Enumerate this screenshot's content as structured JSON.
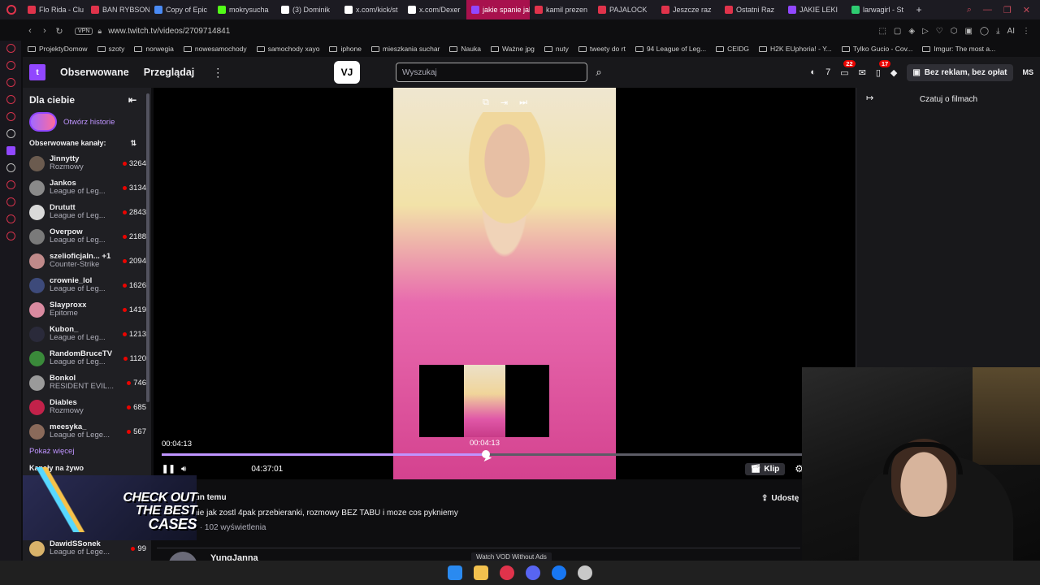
{
  "browser": {
    "tabs": [
      {
        "label": "Flo Rida - Clu",
        "color": "#e0334b"
      },
      {
        "label": "BAN RYBSON",
        "color": "#e0334b"
      },
      {
        "label": "Copy of Epic",
        "color": "#4a8af4"
      },
      {
        "label": "mokrysucha",
        "color": "#53fc18"
      },
      {
        "label": "(3) Dominik",
        "color": "#ffffff"
      },
      {
        "label": "x.com/kick/st",
        "color": "#ffffff"
      },
      {
        "label": "x.com/Dexer",
        "color": "#ffffff"
      },
      {
        "label": "jakie spanie jak zos",
        "color": "#9147ff",
        "active": true
      },
      {
        "label": "kamil prezen",
        "color": "#e0334b"
      },
      {
        "label": "PAJALOCK",
        "color": "#e0334b"
      },
      {
        "label": "Jeszcze raz",
        "color": "#e0334b"
      },
      {
        "label": "Ostatni Raz",
        "color": "#e0334b"
      },
      {
        "label": "JAKIE LEKI",
        "color": "#9147ff"
      },
      {
        "label": "larwagirl - St",
        "color": "#2ecc71"
      }
    ],
    "url": "www.twitch.tv/videos/2709714841",
    "vpn_label": "VPN",
    "bookmarks": [
      "ProjektyDomow",
      "szoty",
      "norwegia",
      "nowesamochody",
      "samochody xayo",
      "iphone",
      "mieszkania suchar",
      "Nauka",
      "Ważne jpg",
      "nuty",
      "tweety do rt",
      "94 League of Leg...",
      "CEIDG",
      "H2K EUphoria! - Y...",
      "Tylko Gucio - Cov...",
      "Imgur: The most a..."
    ]
  },
  "twitch": {
    "nav": {
      "following": "Obserwowane",
      "browse": "Przeglądaj",
      "search_placeholder": "Wyszukaj",
      "notif_count": "22",
      "inbox_count": "17",
      "adfree": "Bez reklam, bez opłat",
      "user_initials": "MS",
      "ai_label": "AI"
    },
    "sidebar": {
      "title": "Dla ciebie",
      "story_label": "Otwórz historie",
      "followed_title": "Obserwowane kanały:",
      "channels": [
        {
          "name": "Jinnytty",
          "category": "Rozmowy",
          "viewers": "3264",
          "color": "#6b5b4f"
        },
        {
          "name": "Jankos",
          "category": "League of Leg...",
          "viewers": "3134",
          "color": "#8a8a8a"
        },
        {
          "name": "Drututt",
          "category": "League of Leg...",
          "viewers": "2843",
          "color": "#d9d9d9"
        },
        {
          "name": "Overpow",
          "category": "League of Leg...",
          "viewers": "2188",
          "color": "#7a7a7a"
        },
        {
          "name": "szelioficjaln... +1",
          "category": "Counter-Strike",
          "viewers": "2094",
          "color": "#c08a8a"
        },
        {
          "name": "crownie_lol",
          "category": "League of Leg...",
          "viewers": "1626",
          "color": "#3d4a7a"
        },
        {
          "name": "Slayproxx",
          "category": "Epitome",
          "viewers": "1419",
          "color": "#d98aa0"
        },
        {
          "name": "Kubon_",
          "category": "League of Leg...",
          "viewers": "1213",
          "color": "#2a2a3a"
        },
        {
          "name": "RandomBruceTV",
          "category": "League of Leg...",
          "viewers": "1120",
          "color": "#3a8a3a"
        },
        {
          "name": "Bonkol",
          "category": "RESIDENT EVIL...",
          "viewers": "746",
          "color": "#9a9a9a"
        },
        {
          "name": "Diables",
          "category": "Rozmowy",
          "viewers": "685",
          "color": "#c2224a"
        },
        {
          "name": "meesyka_",
          "category": "League of Lege...",
          "viewers": "567",
          "color": "#8a6a5a"
        }
      ],
      "show_more": "Pokaż więcej",
      "live_title": "Kanały na żywo",
      "last_channel": {
        "name": "DawidSSonek",
        "category": "League of Lege...",
        "viewers": "99"
      }
    },
    "player": {
      "current_time": "00:04:13",
      "hover_time": "00:04:13",
      "duration": "04:37:01",
      "progress": 0.505,
      "clip_label": "Klip"
    },
    "chat": {
      "title": "Czatuj o filmach"
    },
    "video_info": {
      "ago": "zin temu",
      "title": "nie jak zostl 4pak przebieranki, rozmowy BEZ TABU i moze cos pykniemy",
      "views": "y · 102 wyświetlenia",
      "share": "Udostę",
      "next_channel": "YungJanna"
    }
  },
  "overlay": {
    "promo_line1": "CHECK OUT",
    "promo_line2": "THE BEST",
    "promo_line3": "CASES",
    "vod_banner": "Watch VOD Without Ads"
  }
}
